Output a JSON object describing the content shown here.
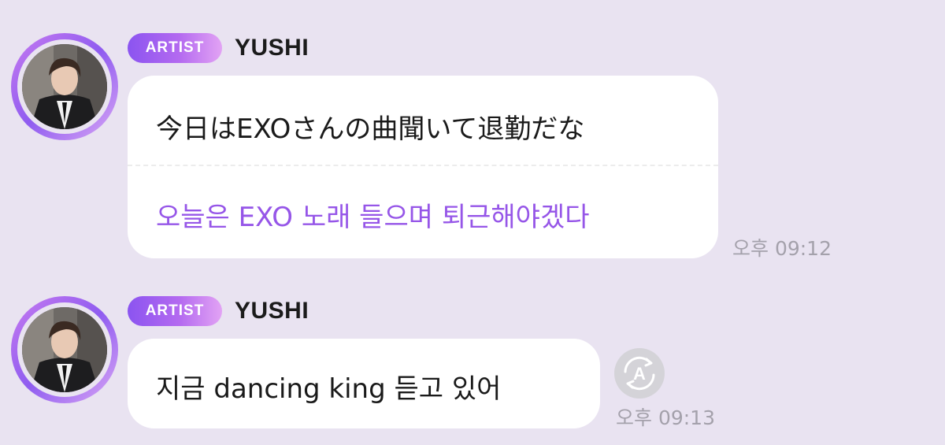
{
  "messages": [
    {
      "badge": "ARTIST",
      "sender": "YUSHI",
      "original": "今日はEXOさんの曲聞いて退勤だな",
      "translation": "오늘은 EXO 노래 들으며 퇴근해야겠다",
      "time": "오후 09:12"
    },
    {
      "badge": "ARTIST",
      "sender": "YUSHI",
      "original": "지금 dancing king 듣고 있어",
      "time": "오후 09:13",
      "action_icon": "translate-icon"
    }
  ],
  "colors": {
    "background": "#e9e3f1",
    "translation_text": "#9656e8",
    "badge_gradient_start": "#8b54f0",
    "badge_gradient_end": "#e2a3f4",
    "timestamp": "#a4a1ab"
  }
}
